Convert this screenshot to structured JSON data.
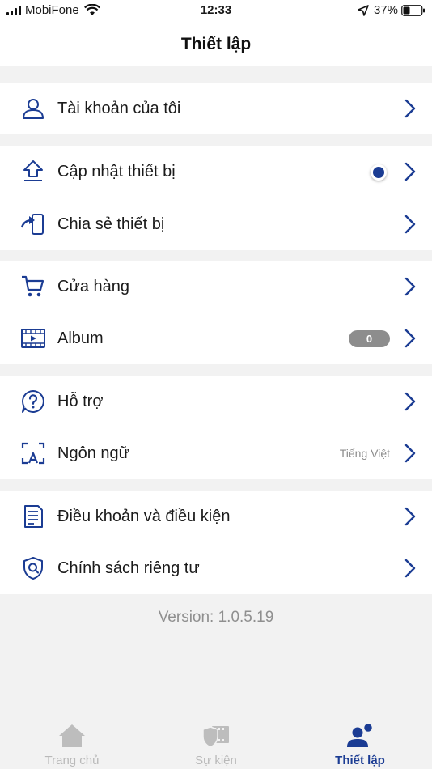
{
  "status_bar": {
    "carrier": "MobiFone",
    "time": "12:33",
    "battery": "37%",
    "battery_level": 0.37
  },
  "header": {
    "title": "Thiết lập"
  },
  "menu": {
    "account": {
      "label": "Tài khoản của tôi",
      "icon": "user-icon"
    },
    "update_device": {
      "label": "Cập nhật thiết bị",
      "icon": "upload-icon"
    },
    "share_device": {
      "label": "Chia sẻ thiết bị",
      "icon": "share-device-icon"
    },
    "store": {
      "label": "Cửa hàng",
      "icon": "cart-icon"
    },
    "album": {
      "label": "Album",
      "icon": "film-icon",
      "count": "0"
    },
    "support": {
      "label": "Hỗ trợ",
      "icon": "help-icon"
    },
    "language": {
      "label": "Ngôn ngữ",
      "icon": "language-icon",
      "value": "Tiếng Việt"
    },
    "terms": {
      "label": "Điều khoản và điều kiện",
      "icon": "document-icon"
    },
    "privacy": {
      "label": "Chính sách riêng tư",
      "icon": "shield-icon"
    }
  },
  "version": "Version: 1.0.5.19",
  "tabs": [
    {
      "label": "Trang chủ",
      "icon": "home-icon",
      "active": false
    },
    {
      "label": "Sự kiện",
      "icon": "events-icon",
      "active": false
    },
    {
      "label": "Thiết lập",
      "icon": "settings-users-icon",
      "active": true
    }
  ],
  "colors": {
    "accent": "#1b3c93",
    "background": "#f2f2f2",
    "inactive_tab": "#b9b9b9",
    "badge": "#8d8d8d"
  }
}
